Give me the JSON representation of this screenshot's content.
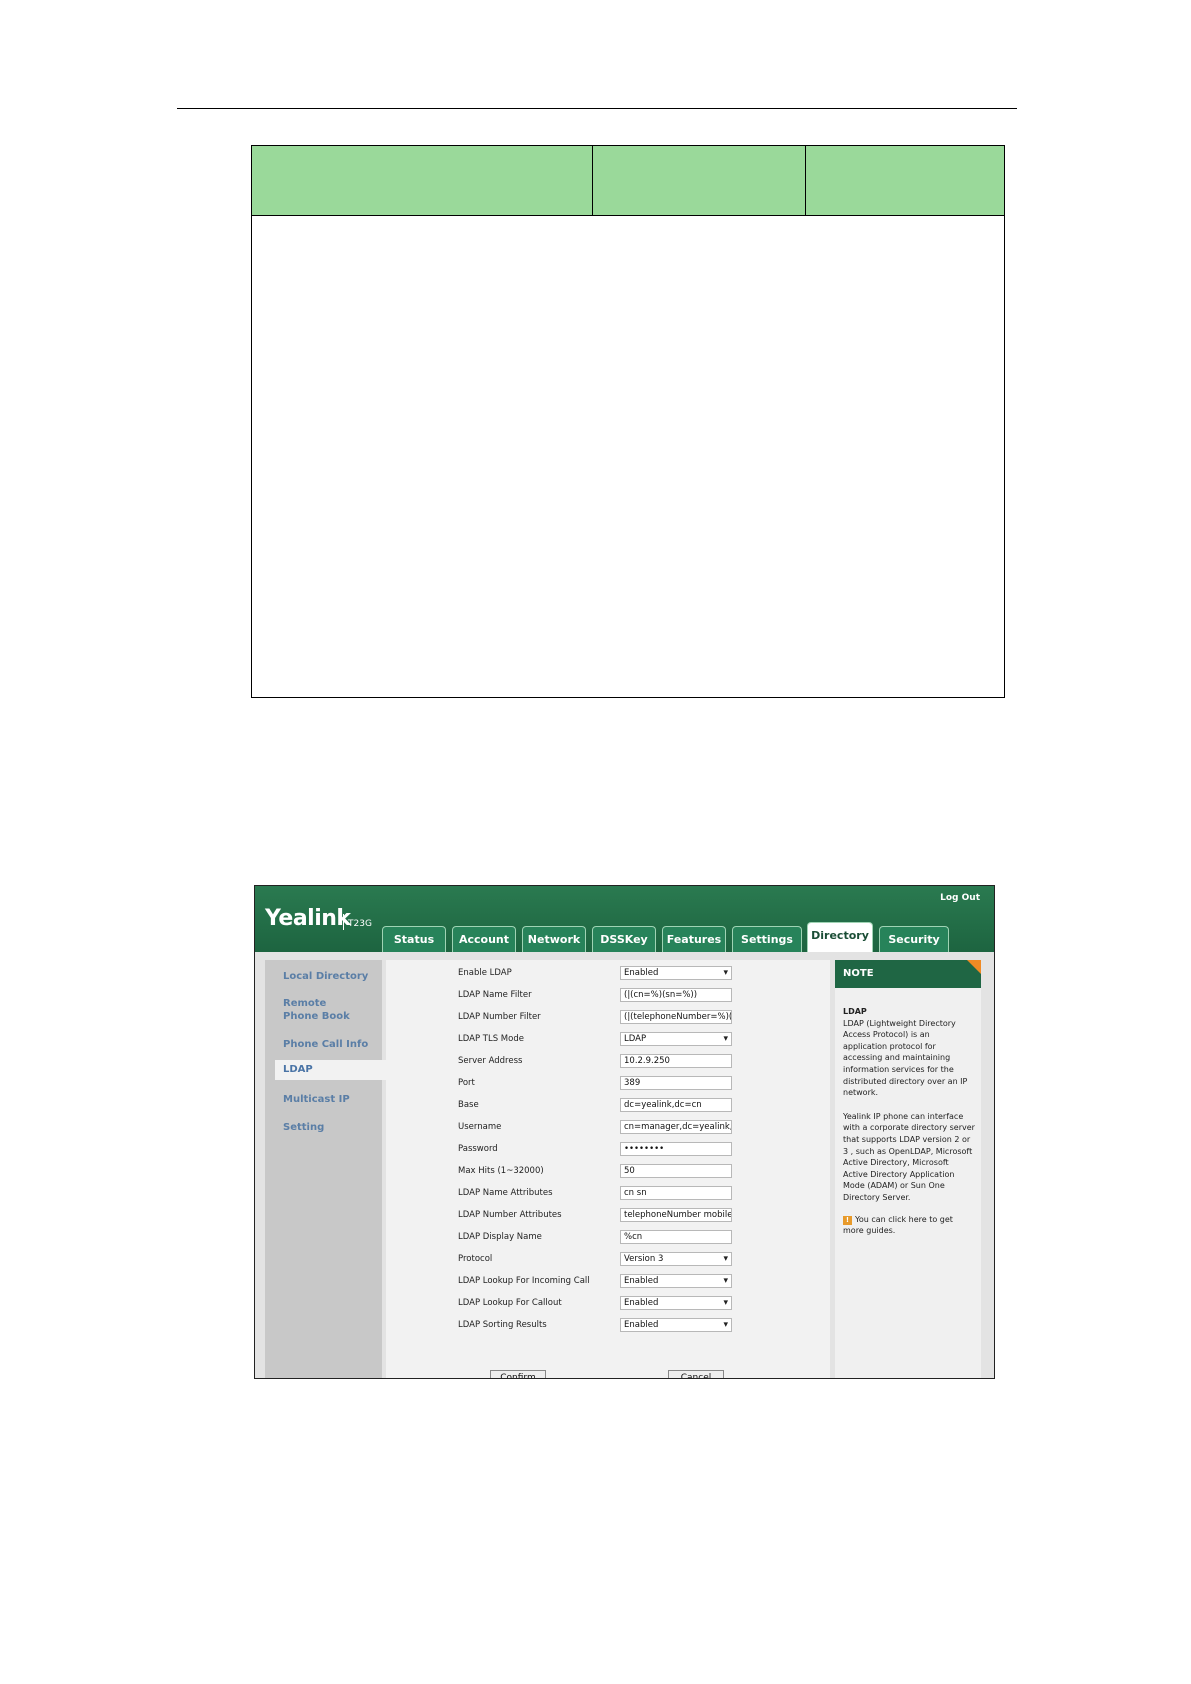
{
  "window": {
    "brand": "Yealink",
    "model": "T23G",
    "logout_label": "Log Out"
  },
  "tabs": [
    {
      "label": "Status"
    },
    {
      "label": "Account"
    },
    {
      "label": "Network"
    },
    {
      "label": "DSSKey"
    },
    {
      "label": "Features"
    },
    {
      "label": "Settings"
    },
    {
      "label": "Directory",
      "active": true
    },
    {
      "label": "Security"
    }
  ],
  "sidebar": {
    "items": [
      {
        "label": "Local Directory"
      },
      {
        "label": "Remote Phone Book"
      },
      {
        "label": "Phone Call Info"
      },
      {
        "label": "LDAP",
        "active": true
      },
      {
        "label": "Multicast IP"
      },
      {
        "label": "Setting"
      }
    ]
  },
  "form": {
    "fields": [
      {
        "label": "Enable LDAP",
        "value": "Enabled",
        "type": "select"
      },
      {
        "label": "LDAP Name Filter",
        "value": "(|(cn=%)(sn=%))",
        "type": "text"
      },
      {
        "label": "LDAP Number Filter",
        "value": "(|(telephoneNumber=%)(m",
        "type": "text"
      },
      {
        "label": "LDAP TLS Mode",
        "value": "LDAP",
        "type": "select"
      },
      {
        "label": "Server Address",
        "value": "10.2.9.250",
        "type": "text"
      },
      {
        "label": "Port",
        "value": "389",
        "type": "text"
      },
      {
        "label": "Base",
        "value": "dc=yealink,dc=cn",
        "type": "text"
      },
      {
        "label": "Username",
        "value": "cn=manager,dc=yealink,dc=",
        "type": "text"
      },
      {
        "label": "Password",
        "value": "••••••••",
        "type": "password"
      },
      {
        "label": "Max Hits (1~32000)",
        "value": "50",
        "type": "text"
      },
      {
        "label": "LDAP Name Attributes",
        "value": "cn sn",
        "type": "text"
      },
      {
        "label": "LDAP Number Attributes",
        "value": "telephoneNumber mobile ip",
        "type": "text"
      },
      {
        "label": "LDAP Display Name",
        "value": "%cn",
        "type": "text"
      },
      {
        "label": "Protocol",
        "value": "Version 3",
        "type": "select"
      },
      {
        "label": "LDAP Lookup For Incoming Call",
        "value": "Enabled",
        "type": "select"
      },
      {
        "label": "LDAP Lookup For Callout",
        "value": "Enabled",
        "type": "select"
      },
      {
        "label": "LDAP Sorting Results",
        "value": "Enabled",
        "type": "select"
      }
    ],
    "confirm_label": "Confirm",
    "cancel_label": "Cancel"
  },
  "note": {
    "header": "NOTE",
    "title": "LDAP",
    "paragraph1": "LDAP (Lightweight Directory Access Protocol) is an application protocol for accessing and maintaining information services for the distributed directory over an IP network.",
    "paragraph2": "Yealink IP phone can interface with a corporate directory server that supports LDAP version 2 or 3 , such as OpenLDAP, Microsoft Active Directory, Microsoft Active Directory Application Mode (ADAM) or Sun One Directory Server.",
    "tip": "You can click here to get more guides."
  },
  "colors": {
    "doc_table_header": "#9ad99a",
    "topbar": "#1d6440",
    "note_corner": "#f08a24",
    "sidebar_link": "#5a7ea6"
  }
}
